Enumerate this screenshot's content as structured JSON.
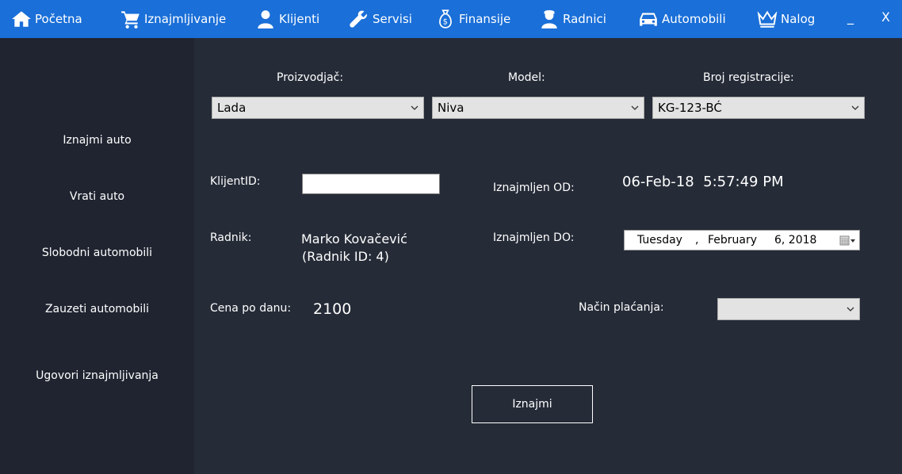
{
  "nav": {
    "home": "Početna",
    "rentals": "Iznajmljivanje",
    "clients": "Klijenti",
    "services": "Servisi",
    "finance": "Finansije",
    "workers": "Radnici",
    "cars": "Automobili",
    "account": "Nalog",
    "minimize": "_",
    "close": "X"
  },
  "sidebar": {
    "items": [
      {
        "label": "Iznajmi auto"
      },
      {
        "label": "Vrati auto"
      },
      {
        "label": "Slobodni automobili"
      },
      {
        "label": "Zauzeti automobili"
      },
      {
        "label": "Ugovori iznajmljivanja"
      }
    ]
  },
  "form": {
    "manufacturer_label": "Proizvodjač:",
    "manufacturer_value": "Lada",
    "model_label": "Model:",
    "model_value": "Niva",
    "registration_label": "Broj registracije:",
    "registration_value": "KG-123-BĆ",
    "client_id_label": "KlijentID:",
    "client_id_value": "",
    "rented_from_label": "Iznajmljen OD:",
    "rented_from_value": "06-Feb-18  5:57:49 PM",
    "worker_label": "Radnik:",
    "worker_name": "Marko Kovačević",
    "worker_id": "(Radnik ID: 4)",
    "rented_to_label": "Iznajmljen DO:",
    "rented_to_weekday": "Tuesday",
    "rented_to_comma": ",",
    "rented_to_month": "February",
    "rented_to_daynum": "6, 2018",
    "price_label": "Cena po danu:",
    "price_value": "2100",
    "payment_label": "Način plaćanja:",
    "payment_value": "",
    "submit_label": "Iznajmi"
  }
}
